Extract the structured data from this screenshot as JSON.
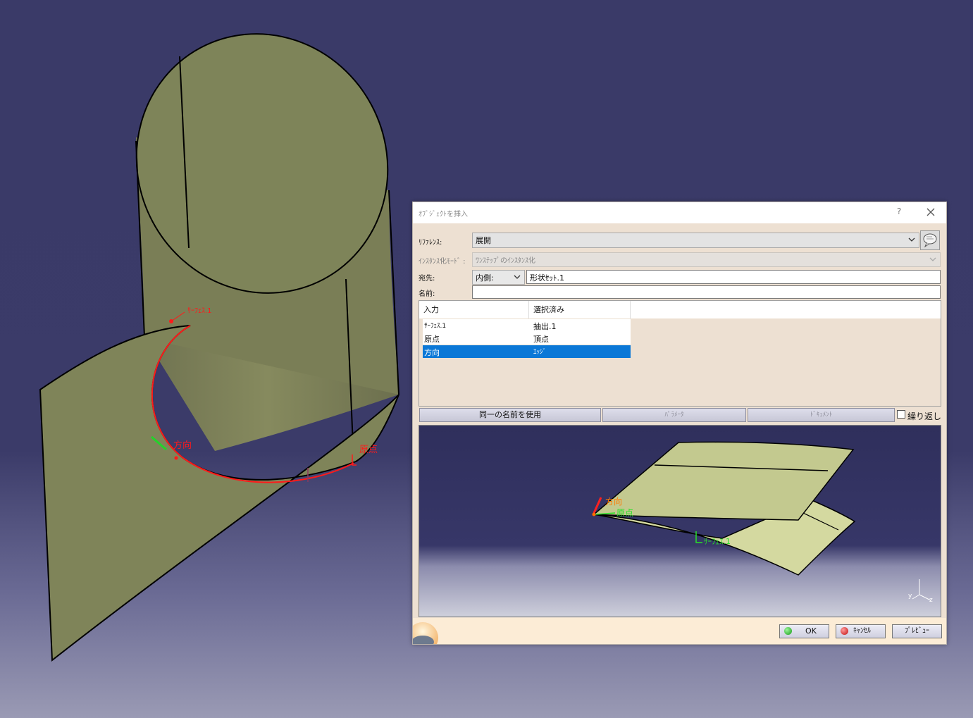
{
  "viewport": {
    "label_surface": "ｻｰﾌｪｽ.1",
    "label_direction": "方向",
    "label_origin": "原点"
  },
  "dialog": {
    "title": "ｵﾌﾞｼﾞｪｸﾄを挿入",
    "help": "?",
    "reference_label": "ﾘﾌｧﾚﾝｽ:",
    "reference_value": "展開",
    "instantiation_label": "ｲﾝｽﾀﾝｽ化ﾓｰﾄﾞ :",
    "instantiation_value": "ﾜﾝｽﾃｯﾌﾟのｲﾝｽﾀﾝｽ化",
    "destination_label": "宛先:",
    "destination_mode": "内側:",
    "destination_value": "形状ｾｯﾄ.1",
    "name_label": "名前:",
    "name_value": "",
    "table": {
      "headers": [
        "入力",
        "選択済み"
      ],
      "rows": [
        {
          "input": "ｻｰﾌｪｽ.1",
          "selected": "抽出.1"
        },
        {
          "input": "原点",
          "selected": "頂点"
        },
        {
          "input": "方向",
          "selected": "ｴｯｼﾞ"
        }
      ],
      "selected_index": 2
    },
    "buttons": {
      "same_name": "同一の名前を使用",
      "parameters": "ﾊﾟﾗﾒｰﾀ",
      "documents": "ﾄﾞｷｭﾒﾝﾄ",
      "repeat": "繰り返し"
    },
    "preview": {
      "label_direction": "方向",
      "label_origin": "原点",
      "label_surface": "ｻｰﾌｪｽ.1",
      "axis_z": "z",
      "axis_y": "y"
    },
    "footer": {
      "ok": "OK",
      "cancel": "ｷｬﾝｾﾙ",
      "preview": "ﾌﾟﾚﾋﾞｭｰ"
    }
  },
  "colors": {
    "surface": "#7f8459",
    "curve": "#ff1a1a",
    "selection": "#0b78d7"
  }
}
